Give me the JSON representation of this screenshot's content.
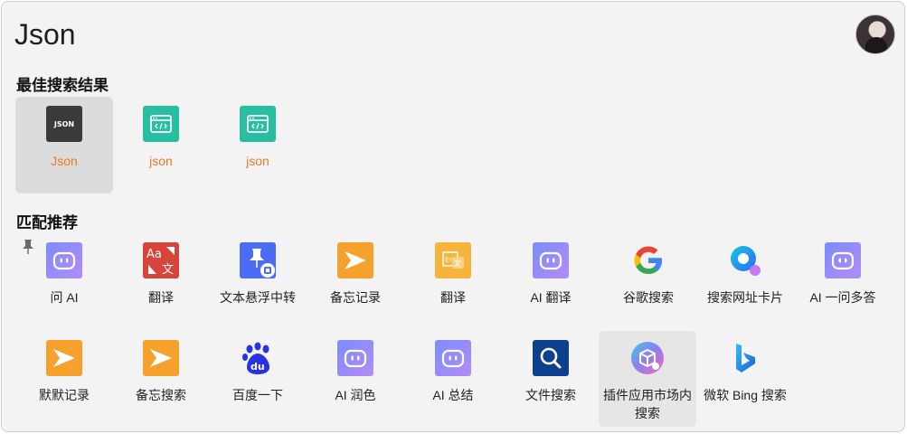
{
  "search": {
    "query": "Json"
  },
  "sections": {
    "best": "最佳搜索结果",
    "match": "匹配推荐"
  },
  "best_results": [
    {
      "label": "Json",
      "icon": "json-text-icon",
      "icon_text": "JSON"
    },
    {
      "label": "json",
      "icon": "code-window-icon"
    },
    {
      "label": "json",
      "icon": "code-window-icon"
    }
  ],
  "row1": [
    {
      "label": "问 AI",
      "icon": "ai-robot-icon"
    },
    {
      "label": "翻译",
      "icon": "translate-icon"
    },
    {
      "label": "文本悬浮中转",
      "icon": "pin-float-icon"
    },
    {
      "label": "备忘记录",
      "icon": "memo-star-icon"
    },
    {
      "label": "翻译",
      "icon": "translate-alt-icon"
    },
    {
      "label": "AI 翻译",
      "icon": "ai-robot-icon"
    },
    {
      "label": "谷歌搜索",
      "icon": "google-icon"
    },
    {
      "label": "搜索网址卡片",
      "icon": "search-url-icon"
    },
    {
      "label": "AI 一问多答",
      "icon": "ai-robot-icon"
    }
  ],
  "row2": [
    {
      "label": "默默记录",
      "icon": "memo-star-icon"
    },
    {
      "label": "备忘搜索",
      "icon": "memo-star-icon"
    },
    {
      "label": "百度一下",
      "icon": "baidu-paw-icon"
    },
    {
      "label": "AI 润色",
      "icon": "ai-robot-icon"
    },
    {
      "label": "AI 总结",
      "icon": "ai-robot-icon"
    },
    {
      "label": "文件搜索",
      "icon": "file-search-icon"
    },
    {
      "label": "插件应用市场内搜索",
      "icon": "plugin-market-icon"
    },
    {
      "label": "微软 Bing 搜索",
      "icon": "bing-icon"
    }
  ],
  "colors": {
    "accent_orange": "#e57b25",
    "highlight_bg": "#dcdcdc",
    "window_bg": "#f3f3f3"
  }
}
